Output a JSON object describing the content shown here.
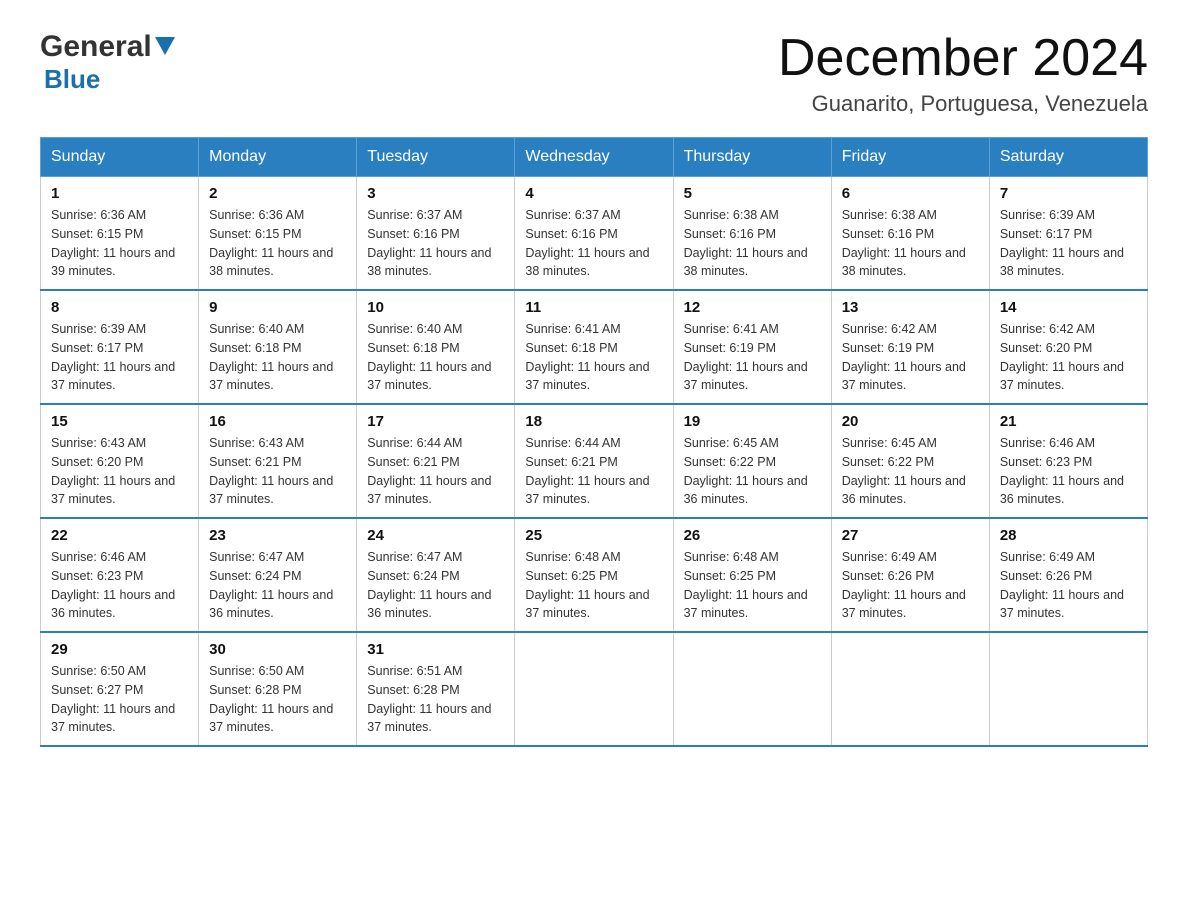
{
  "logo": {
    "general": "General",
    "blue": "Blue",
    "arrow": "▼"
  },
  "title": "December 2024",
  "location": "Guanarito, Portuguesa, Venezuela",
  "days_of_week": [
    "Sunday",
    "Monday",
    "Tuesday",
    "Wednesday",
    "Thursday",
    "Friday",
    "Saturday"
  ],
  "weeks": [
    [
      {
        "day": "1",
        "sunrise": "6:36 AM",
        "sunset": "6:15 PM",
        "daylight": "11 hours and 39 minutes."
      },
      {
        "day": "2",
        "sunrise": "6:36 AM",
        "sunset": "6:15 PM",
        "daylight": "11 hours and 38 minutes."
      },
      {
        "day": "3",
        "sunrise": "6:37 AM",
        "sunset": "6:16 PM",
        "daylight": "11 hours and 38 minutes."
      },
      {
        "day": "4",
        "sunrise": "6:37 AM",
        "sunset": "6:16 PM",
        "daylight": "11 hours and 38 minutes."
      },
      {
        "day": "5",
        "sunrise": "6:38 AM",
        "sunset": "6:16 PM",
        "daylight": "11 hours and 38 minutes."
      },
      {
        "day": "6",
        "sunrise": "6:38 AM",
        "sunset": "6:16 PM",
        "daylight": "11 hours and 38 minutes."
      },
      {
        "day": "7",
        "sunrise": "6:39 AM",
        "sunset": "6:17 PM",
        "daylight": "11 hours and 38 minutes."
      }
    ],
    [
      {
        "day": "8",
        "sunrise": "6:39 AM",
        "sunset": "6:17 PM",
        "daylight": "11 hours and 37 minutes."
      },
      {
        "day": "9",
        "sunrise": "6:40 AM",
        "sunset": "6:18 PM",
        "daylight": "11 hours and 37 minutes."
      },
      {
        "day": "10",
        "sunrise": "6:40 AM",
        "sunset": "6:18 PM",
        "daylight": "11 hours and 37 minutes."
      },
      {
        "day": "11",
        "sunrise": "6:41 AM",
        "sunset": "6:18 PM",
        "daylight": "11 hours and 37 minutes."
      },
      {
        "day": "12",
        "sunrise": "6:41 AM",
        "sunset": "6:19 PM",
        "daylight": "11 hours and 37 minutes."
      },
      {
        "day": "13",
        "sunrise": "6:42 AM",
        "sunset": "6:19 PM",
        "daylight": "11 hours and 37 minutes."
      },
      {
        "day": "14",
        "sunrise": "6:42 AM",
        "sunset": "6:20 PM",
        "daylight": "11 hours and 37 minutes."
      }
    ],
    [
      {
        "day": "15",
        "sunrise": "6:43 AM",
        "sunset": "6:20 PM",
        "daylight": "11 hours and 37 minutes."
      },
      {
        "day": "16",
        "sunrise": "6:43 AM",
        "sunset": "6:21 PM",
        "daylight": "11 hours and 37 minutes."
      },
      {
        "day": "17",
        "sunrise": "6:44 AM",
        "sunset": "6:21 PM",
        "daylight": "11 hours and 37 minutes."
      },
      {
        "day": "18",
        "sunrise": "6:44 AM",
        "sunset": "6:21 PM",
        "daylight": "11 hours and 37 minutes."
      },
      {
        "day": "19",
        "sunrise": "6:45 AM",
        "sunset": "6:22 PM",
        "daylight": "11 hours and 36 minutes."
      },
      {
        "day": "20",
        "sunrise": "6:45 AM",
        "sunset": "6:22 PM",
        "daylight": "11 hours and 36 minutes."
      },
      {
        "day": "21",
        "sunrise": "6:46 AM",
        "sunset": "6:23 PM",
        "daylight": "11 hours and 36 minutes."
      }
    ],
    [
      {
        "day": "22",
        "sunrise": "6:46 AM",
        "sunset": "6:23 PM",
        "daylight": "11 hours and 36 minutes."
      },
      {
        "day": "23",
        "sunrise": "6:47 AM",
        "sunset": "6:24 PM",
        "daylight": "11 hours and 36 minutes."
      },
      {
        "day": "24",
        "sunrise": "6:47 AM",
        "sunset": "6:24 PM",
        "daylight": "11 hours and 36 minutes."
      },
      {
        "day": "25",
        "sunrise": "6:48 AM",
        "sunset": "6:25 PM",
        "daylight": "11 hours and 37 minutes."
      },
      {
        "day": "26",
        "sunrise": "6:48 AM",
        "sunset": "6:25 PM",
        "daylight": "11 hours and 37 minutes."
      },
      {
        "day": "27",
        "sunrise": "6:49 AM",
        "sunset": "6:26 PM",
        "daylight": "11 hours and 37 minutes."
      },
      {
        "day": "28",
        "sunrise": "6:49 AM",
        "sunset": "6:26 PM",
        "daylight": "11 hours and 37 minutes."
      }
    ],
    [
      {
        "day": "29",
        "sunrise": "6:50 AM",
        "sunset": "6:27 PM",
        "daylight": "11 hours and 37 minutes."
      },
      {
        "day": "30",
        "sunrise": "6:50 AM",
        "sunset": "6:28 PM",
        "daylight": "11 hours and 37 minutes."
      },
      {
        "day": "31",
        "sunrise": "6:51 AM",
        "sunset": "6:28 PM",
        "daylight": "11 hours and 37 minutes."
      },
      null,
      null,
      null,
      null
    ]
  ],
  "labels": {
    "sunrise": "Sunrise:",
    "sunset": "Sunset:",
    "daylight": "Daylight:"
  }
}
